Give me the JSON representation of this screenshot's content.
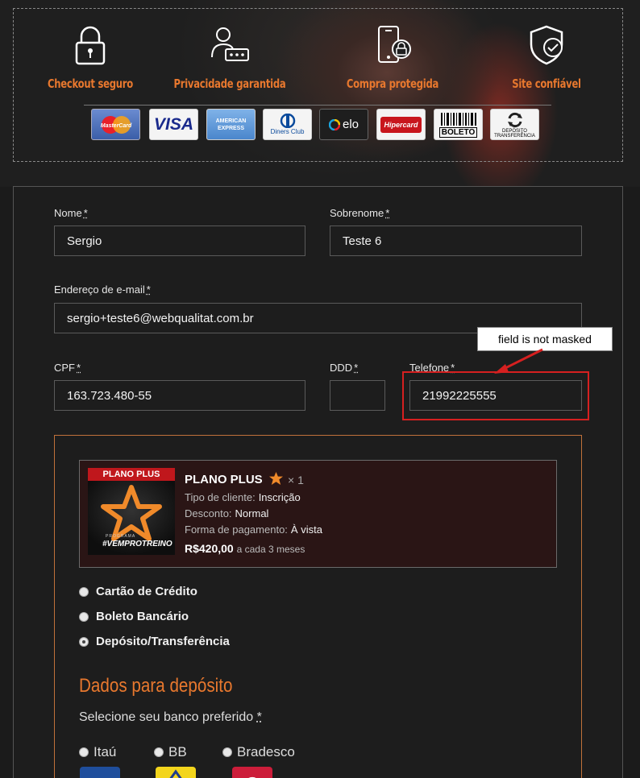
{
  "trust": {
    "items": [
      {
        "label": "Checkout seguro",
        "icon": "padlock-icon"
      },
      {
        "label": "Privacidade garantida",
        "icon": "user-password-icon"
      },
      {
        "label": "Compra protegida",
        "icon": "phone-lock-icon"
      },
      {
        "label": "Site confiável",
        "icon": "shield-check-icon"
      }
    ],
    "payment_logos": [
      {
        "label": "MasterCard",
        "name": "mastercard-logo"
      },
      {
        "label": "VISA",
        "name": "visa-logo"
      },
      {
        "label": "AMERICAN EXPRESS",
        "name": "amex-logo"
      },
      {
        "label": "Diners Club",
        "name": "diners-logo"
      },
      {
        "label": "elo",
        "name": "elo-logo"
      },
      {
        "label": "Hipercard",
        "name": "hipercard-logo"
      },
      {
        "label": "BOLETO",
        "name": "boleto-logo"
      },
      {
        "label": "DEPÓSITO TRANSFERÊNCIA",
        "name": "deposito-logo"
      }
    ]
  },
  "form": {
    "nome": {
      "label": "Nome",
      "required": "*",
      "value": "Sergio"
    },
    "sobrenome": {
      "label": "Sobrenome",
      "required": "*",
      "value": "Teste 6"
    },
    "email": {
      "label": "Endereço de e-mail",
      "required": "*",
      "value": "sergio+teste6@webqualitat.com.br"
    },
    "cpf": {
      "label": "CPF",
      "required": "*",
      "value": "163.723.480-55"
    },
    "ddd": {
      "label": "DDD",
      "required": "*",
      "value": ""
    },
    "telefone": {
      "label": "Telefone",
      "required": "*",
      "value": "21992225555"
    }
  },
  "annotation": {
    "text": "field is not masked",
    "color": "#d62020"
  },
  "product": {
    "banner": "PLANO PLUS",
    "logo_text_top": "PROGRAMA",
    "logo_text": "#VEMPROTREINO",
    "title": "PLANO PLUS",
    "quantity": "× 1",
    "rows": [
      {
        "label": "Tipo de cliente:",
        "value": "Inscrição"
      },
      {
        "label": "Desconto:",
        "value": "Normal"
      },
      {
        "label": "Forma de pagamento:",
        "value": "À vista"
      }
    ],
    "price": "R$420,00",
    "period": "a cada 3 meses"
  },
  "payment_methods": [
    {
      "label": "Cartão de Crédito",
      "checked": false
    },
    {
      "label": "Boleto Bancário",
      "checked": false
    },
    {
      "label": "Depósito/Transferência",
      "checked": true
    }
  ],
  "deposit": {
    "title": "Dados para depósito",
    "prompt": "Selecione seu banco preferido",
    "required": "*",
    "banks": [
      {
        "label": "Itaú",
        "color": "#1f4e9c"
      },
      {
        "label": "BB",
        "color": "#f3d51c"
      },
      {
        "label": "Bradesco",
        "color": "#cc1d3a"
      }
    ]
  },
  "colors": {
    "accent": "#e8782e",
    "panel": "#1d1d1d",
    "product_bg": "#2a1515"
  }
}
